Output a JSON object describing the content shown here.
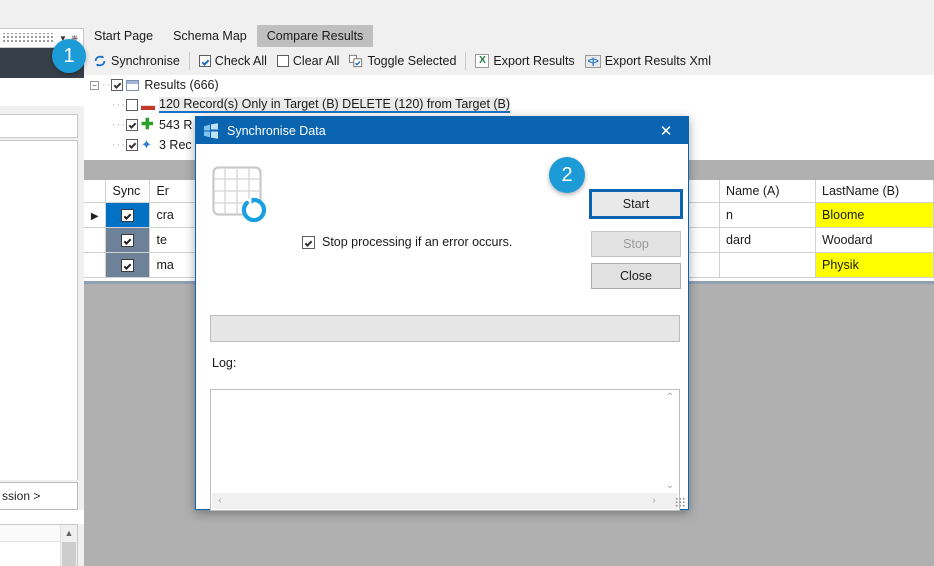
{
  "left_panel": {
    "combo_caret": "▼",
    "pin_icon": "pin-icon",
    "expression_text": "ssion >",
    "expression_gt": ">"
  },
  "tabs": [
    {
      "label": "Start Page",
      "active": false
    },
    {
      "label": "Schema Map",
      "active": false
    },
    {
      "label": "Compare Results",
      "active": true
    }
  ],
  "toolbar": {
    "synchronise": "Synchronise",
    "check_all": "Check All",
    "clear_all": "Clear All",
    "toggle_selected": "Toggle Selected",
    "export_results": "Export Results",
    "export_results_xml": "Export Results Xml",
    "xls_icon_text": "X",
    "xml_icon_text": "<|>"
  },
  "tree": {
    "root": "Results (666)",
    "nodes": [
      {
        "label": "120 Record(s) Only in Target (B) DELETE (120) from Target (B)",
        "checked": false,
        "icon": "minus-icon",
        "selected": true
      },
      {
        "label": "543 R",
        "checked": true,
        "icon": "plus-icon",
        "selected": false
      },
      {
        "label": "3 Rec",
        "checked": true,
        "icon": "diamond-icon",
        "selected": false
      }
    ]
  },
  "grid": {
    "columns": [
      "",
      "Sync",
      "Er",
      "Name (A)",
      "LastName (B)"
    ],
    "rows": [
      {
        "selected": true,
        "sync_checked": true,
        "er": "cra",
        "name_a": "n",
        "lastname_b": "Bloome",
        "lastname_highlight": true
      },
      {
        "selected": false,
        "sync_checked": true,
        "er": "te",
        "name_a": "dard",
        "lastname_b": "Woodard",
        "lastname_highlight": false
      },
      {
        "selected": false,
        "sync_checked": true,
        "er": "ma",
        "name_a": "",
        "lastname_b": "Physik",
        "lastname_highlight": true
      }
    ]
  },
  "dialog": {
    "title": "Synchronise Data",
    "icon": "sync-data-icon",
    "close_label": "✕",
    "stop_on_error_label": "Stop processing if an error occurs.",
    "stop_on_error_checked": true,
    "buttons": {
      "start": "Start",
      "stop": "Stop",
      "close": "Close"
    },
    "start_focused": true,
    "stop_disabled": true,
    "progress_value": "",
    "log_label": "Log:",
    "log_text": "",
    "scroll_up": "⌃",
    "scroll_down": "⌄",
    "scroll_left": "‹",
    "scroll_right": "›"
  },
  "callouts": [
    {
      "number": "1"
    },
    {
      "number": "2"
    }
  ],
  "colors": {
    "accent_blue": "#0a64b0",
    "badge_blue": "#1d9bd7",
    "highlight_yellow": "#ffff00",
    "row_selected_blue": "#0072c6",
    "sync_cell_grey": "#6d8299",
    "background_grey": "#b0b0b0"
  }
}
